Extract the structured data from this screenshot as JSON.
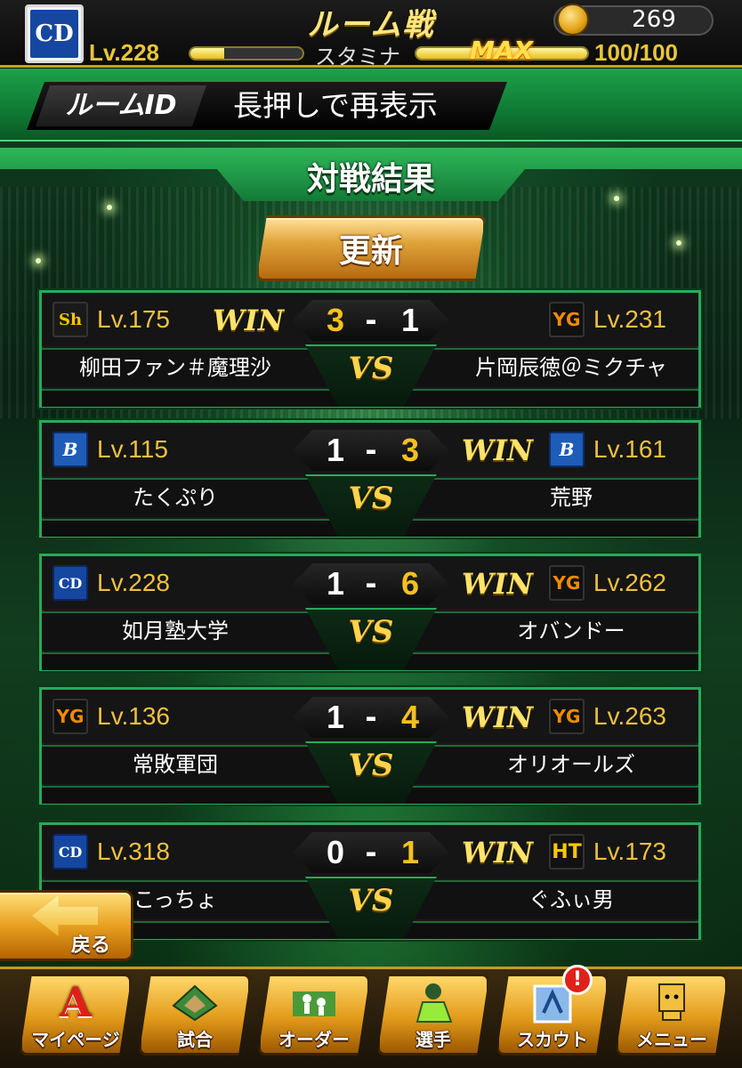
{
  "header": {
    "title": "ルーム戦",
    "player_level": "Lv.228",
    "stamina_label": "スタミナ",
    "stamina_max_label": "MAX",
    "stamina_value": "100/100",
    "stamina_fill": 1.0,
    "xp_fill": 0.3,
    "coins": "269",
    "team_logo_text": "CD"
  },
  "room": {
    "id_tag": "ルームID",
    "id_text": "長押しで再表示"
  },
  "results": {
    "title": "対戦結果",
    "refresh_label": "更新",
    "win_label": "WIN",
    "vs_label": "VS",
    "dash": "-",
    "matches": [
      {
        "left": {
          "team": "hawks",
          "icon": "Sh",
          "level": "Lv.175",
          "name": "柳田ファン＃魔理沙",
          "score": "3",
          "win": true
        },
        "right": {
          "team": "giants",
          "icon": "YG",
          "level": "Lv.231",
          "name": "片岡辰徳＠ミクチャ",
          "score": "1",
          "win": false
        }
      },
      {
        "left": {
          "team": "baystars",
          "icon": "B",
          "level": "Lv.115",
          "name": "たくぷり",
          "score": "1",
          "win": false
        },
        "right": {
          "team": "baystars",
          "icon": "B",
          "level": "Lv.161",
          "name": "荒野",
          "score": "3",
          "win": true
        }
      },
      {
        "left": {
          "team": "dragons",
          "icon": "CD",
          "level": "Lv.228",
          "name": "如月塾大学",
          "score": "1",
          "win": false
        },
        "right": {
          "team": "giants",
          "icon": "YG",
          "level": "Lv.262",
          "name": "オバンドー",
          "score": "6",
          "win": true
        }
      },
      {
        "left": {
          "team": "giants",
          "icon": "YG",
          "level": "Lv.136",
          "name": "常敗軍団",
          "score": "1",
          "win": false
        },
        "right": {
          "team": "giants",
          "icon": "YG",
          "level": "Lv.263",
          "name": "オリオールズ",
          "score": "4",
          "win": true
        }
      },
      {
        "left": {
          "team": "dragons",
          "icon": "CD",
          "level": "Lv.318",
          "name": "こっちょ",
          "score": "0",
          "win": false
        },
        "right": {
          "team": "tigers",
          "icon": "HT",
          "level": "Lv.173",
          "name": "ぐふぃ男",
          "score": "1",
          "win": true
        }
      }
    ]
  },
  "back": {
    "label": "戻る"
  },
  "nav": {
    "items": [
      {
        "label": "マイページ",
        "icon": "A"
      },
      {
        "label": "試合",
        "icon": "field-icon"
      },
      {
        "label": "オーダー",
        "icon": "order-icon"
      },
      {
        "label": "選手",
        "icon": "player-icon"
      },
      {
        "label": "スカウト",
        "icon": "scout-icon"
      },
      {
        "label": "メニュー",
        "icon": "menu-icon"
      }
    ],
    "scout_badge": "!"
  },
  "colors": {
    "accent_green": "#2aa85a",
    "gold": "#e8c53a",
    "win_yellow": "#ffe26a",
    "score_winner": "#f5c020",
    "score_loser": "#ffffff"
  }
}
